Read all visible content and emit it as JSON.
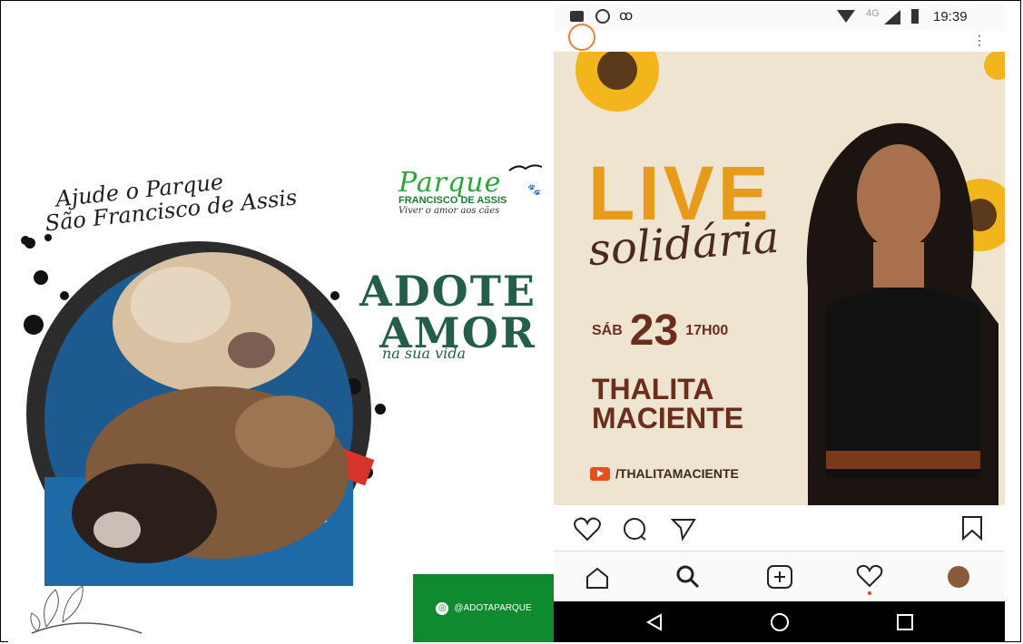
{
  "left_panel": {
    "script_line1": "Ajude o Parque",
    "script_line2": "São Francisco de Assis",
    "brand_name": "Parque",
    "brand_sub": "FRANCISCO DE ASSIS",
    "brand_tag": "Viver o amor aos cães",
    "headline1": "ADOTE",
    "headline2": "AMOR",
    "headline_sub": "na sua vida",
    "instagram_handle": "@ADOTAPARQUE"
  },
  "right_panel": {
    "status": {
      "network": "4G",
      "time": "19:39"
    },
    "post": {
      "title": "LIVE",
      "subtitle": "solidária",
      "day_label": "SÁB",
      "day": "23",
      "hour": "17H00",
      "artist_line1": "THALITA",
      "artist_line2": "MACIENTE",
      "youtube": "/THALITAMACIENTE"
    },
    "actions": [
      "heart-icon",
      "comment-icon",
      "share-icon",
      "bookmark-icon"
    ],
    "nav_items": [
      "home-icon",
      "search-icon",
      "add-icon",
      "activity-icon",
      "profile-icon"
    ],
    "system_nav": [
      "back-icon",
      "home-circle-icon",
      "recents-icon"
    ]
  },
  "colors": {
    "brand_green": "#2aa637",
    "headline_green": "#245e4a",
    "instagram_bar": "#0f8a2e",
    "live_orange": "#e89a1a",
    "artist_brown": "#6a2e1d"
  }
}
